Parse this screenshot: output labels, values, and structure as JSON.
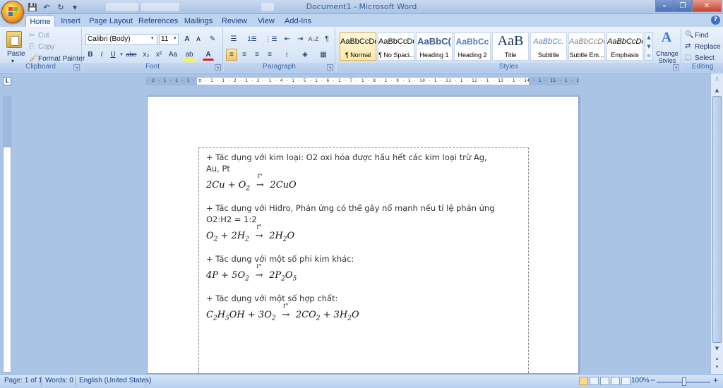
{
  "window": {
    "title": "Document1 - Microsoft Word",
    "controls": [
      "–",
      "❐",
      "✕"
    ]
  },
  "quick_access": {
    "save": "💾",
    "undo": "↶",
    "redo": "↻",
    "more": "▾"
  },
  "tabs": [
    "Home",
    "Insert",
    "Page Layout",
    "References",
    "Mailings",
    "Review",
    "View",
    "Add-Ins"
  ],
  "active_tab": "Home",
  "ribbon": {
    "clipboard": {
      "label": "Clipboard",
      "paste": "Paste",
      "cut": "Cut",
      "copy": "Copy",
      "format_painter": "Format Painter"
    },
    "font": {
      "label": "Font",
      "font_name": "Calibri (Body)",
      "font_size": "11",
      "grow": "A",
      "shrink": "A",
      "clear": "✎",
      "bold": "B",
      "italic": "I",
      "underline": "U",
      "strike": "abe",
      "subscript": "x₂",
      "superscript": "x²",
      "change_case": "Aa",
      "highlight": "ab",
      "font_color": "A"
    },
    "paragraph": {
      "label": "Paragraph",
      "bullets": "☰",
      "numbering": "1☰",
      "multilevel": "⋮☰",
      "dec_indent": "⇤",
      "inc_indent": "⇥",
      "sort": "A↓Z",
      "show_marks": "¶",
      "align_left": "≡",
      "center": "≡",
      "align_right": "≡",
      "justify": "≡",
      "line_spacing": "↕",
      "shading": "◈",
      "borders": "▦"
    },
    "styles": {
      "label": "Styles",
      "items": [
        {
          "preview": "AaBbCcDc",
          "name": "¶ Normal"
        },
        {
          "preview": "AaBbCcDc",
          "name": "¶ No Spaci..."
        },
        {
          "preview": "AaBbC(",
          "name": "Heading 1"
        },
        {
          "preview": "AaBbCc",
          "name": "Heading 2"
        },
        {
          "preview": "AaB",
          "name": "Title"
        },
        {
          "preview": "AaBbCc.",
          "name": "Subtitle"
        },
        {
          "preview": "AaBbCcDc",
          "name": "Subtle Em..."
        },
        {
          "preview": "AaBbCcDc",
          "name": "Emphasis"
        }
      ],
      "change_styles": "Change Styles"
    },
    "editing": {
      "label": "Editing",
      "find": "Find",
      "replace": "Replace",
      "select": "Select"
    }
  },
  "ruler_text": "· 2 · 1 · 1 · 1 · ⧖ · 1 · 1 · 2 · 1 · 3 · 1 · 4 · 1 · 5 · 1 · 6 · 1 · 7 · 1 · 8 · 1 · 9 · 1 · 10 · 1 · 11 · 1 · 12 · 1 · 13 · 1 · 14 · 1 · 15 · 1 · 16 · △ · 17 · 1 · 18 · 1 · 19",
  "ruler_corner": "L",
  "document": {
    "line1": "+ Tác dụng với kim loại: O2 oxi hóa được hầu hết các kim loại trừ Ag,",
    "line1b": "Au, Pt",
    "eq1": {
      "lhs": "2Cu + O",
      "lhs_sub": "2",
      "cond": "t°",
      "rhs": "2CuO"
    },
    "line2": "+ Tác dụng với Hiđro, Phản ứng có thể gây nổ mạnh nếu tỉ lệ phản ứng",
    "line2b": "O2:H2 = 1:2",
    "eq2": {
      "a": "O",
      "a_sub": "2",
      "b": " + 2H",
      "b_sub": "2",
      "cond": "t°",
      "c": "2H",
      "c_sub": "2",
      "d": "O"
    },
    "line3": "+ Tác dụng với một số phi kim khác:",
    "eq3": {
      "a": "4P + 5O",
      "a_sub": "2",
      "cond": "t°",
      "b": "2P",
      "b_sub": "2",
      "c": "O",
      "c_sub": "5"
    },
    "line4": "+ Tác dụng với một số hợp chất:",
    "eq4": {
      "a": "C",
      "a_sub": "2",
      "b": "H",
      "b_sub": "5",
      "c": "OH + 3O",
      "c_sub": "2",
      "cond": "t°",
      "d": "2CO",
      "d_sub": "2",
      "e": " + 3H",
      "e_sub": "2",
      "f": "O"
    }
  },
  "status": {
    "page": "Page: 1 of 1",
    "words": "Words: 0",
    "language": "English (United States)",
    "zoom": "100%",
    "zoom_out": "−",
    "zoom_in": "+"
  }
}
